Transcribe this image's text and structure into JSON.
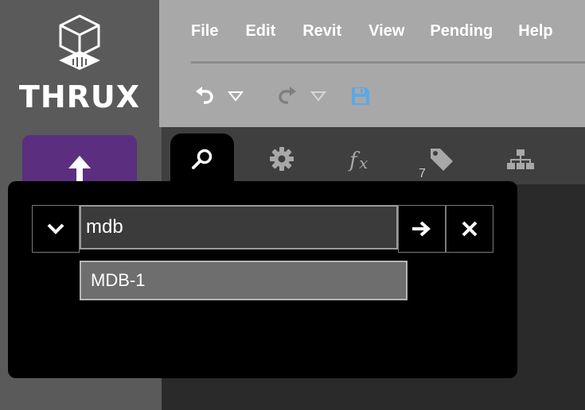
{
  "brand": {
    "name": "THRUX"
  },
  "menu": {
    "items": [
      "File",
      "Edit",
      "Revit",
      "View",
      "Pending",
      "Help"
    ]
  },
  "toolbar": {
    "undo_icon": "undo-icon",
    "redo_icon": "redo-icon",
    "save_icon": "save-icon",
    "save_color": "#5aa9e6"
  },
  "upload": {
    "icon": "upload-arrow-icon",
    "color": "#5c2e80"
  },
  "tabs": {
    "search_icon": "search-icon",
    "settings_icon": "gear-icon",
    "formula_icon": "fx-icon",
    "tags_icon": "tag-icon",
    "tags_count": "7",
    "hierarchy_icon": "hierarchy-icon"
  },
  "search": {
    "value": "mdb",
    "suggestions": [
      "MDB-1"
    ]
  }
}
